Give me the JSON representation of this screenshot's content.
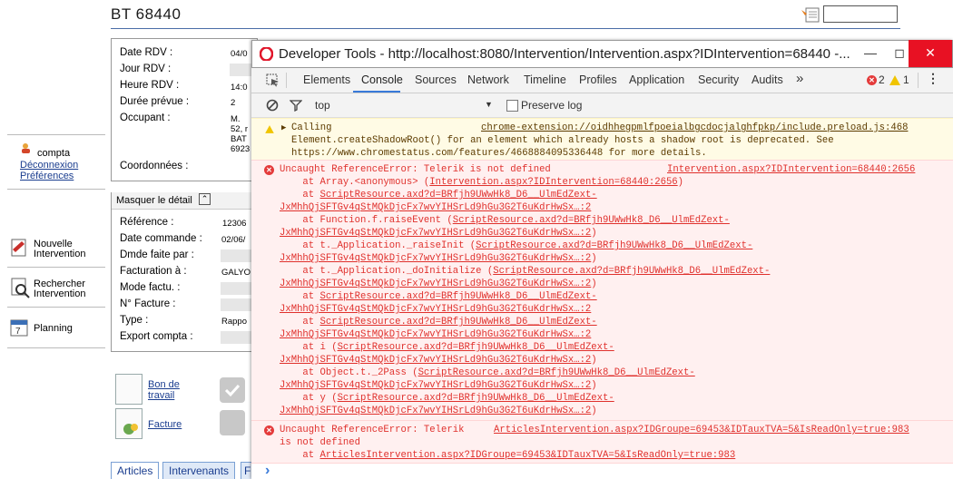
{
  "page": {
    "title": "BT 68440",
    "sidebar": {
      "user": "compta",
      "logout": "Déconnexion",
      "prefs": "Préférences",
      "nouvelle": [
        "Nouvelle",
        "Intervention"
      ],
      "rechercher": [
        "Rechercher",
        "Intervention"
      ],
      "planning": "Planning"
    },
    "panel1": {
      "labels": [
        "Date RDV :",
        "Jour RDV :",
        "Heure RDV :",
        "Durée prévue :",
        "Occupant :",
        "Coordonnées :"
      ],
      "values": [
        "04/0",
        "14:0",
        "2",
        "M.",
        "52, r",
        "BAT",
        "6923"
      ]
    },
    "masquer": "Masquer le détail",
    "panel2": {
      "labels": [
        "Référence :",
        "Date commande :",
        "Dmde faite par :",
        "Facturation à :",
        "Mode factu. :",
        "N° Facture :",
        "Type :",
        "Export compta :"
      ],
      "values": [
        "12306",
        "02/06/",
        "GALYO",
        "Rappo"
      ]
    },
    "bon_de_travail": [
      "Bon de",
      "travail"
    ],
    "facture": "Facture",
    "tabs": [
      "Articles",
      "Intervenants",
      "F"
    ]
  },
  "devtools": {
    "title": "Developer Tools - http://localhost:8080/Intervention/Intervention.aspx?IDIntervention=68440 -...",
    "tabs": [
      "Elements",
      "Console",
      "Sources",
      "Network",
      "Timeline",
      "Profiles",
      "Application",
      "Security",
      "Audits"
    ],
    "active_tab": "Console",
    "more": "»",
    "error_count": "2",
    "warn_count": "1",
    "filter_context": "top",
    "preserve_log": "Preserve log",
    "warning": {
      "text1": "Calling",
      "source": "chrome-extension://oidhhegpmlfpoeialbgcdocjalghfpkp/include.preload.js:468",
      "text2": "Element.createShadowRoot() for an element which already hosts a shadow root is deprecated. See",
      "text3": "https://www.chromestatus.com/features/4668884095336448 for more details."
    },
    "error1": {
      "message": "Uncaught ReferenceError: Telerik is not defined",
      "source": "Intervention.aspx?IDIntervention=68440:2656",
      "stack": [
        {
          "pre": "    at Array.<anonymous> (",
          "link": "Intervention.aspx?IDIntervention=68440:2656",
          "post": ")"
        },
        {
          "pre": "    at ",
          "link": "ScriptResource.axd?d=BRfjh9UWwHk8_D6__UlmEdZext-",
          "post": ""
        },
        {
          "pre": "",
          "link": "JxMhhQjSFTGv4qStMQkDjcFx7wvYIHSrLd9hGu3G2T6uKdrHwSx…:2",
          "post": ""
        },
        {
          "pre": "    at Function.f.raiseEvent (",
          "link": "ScriptResource.axd?d=BRfjh9UWwHk8_D6__UlmEdZext-",
          "post": ""
        },
        {
          "pre": "",
          "link": "JxMhhQjSFTGv4qStMQkDjcFx7wvYIHSrLd9hGu3G2T6uKdrHwSx…:2",
          "post": ")"
        },
        {
          "pre": "    at t._Application._raiseInit (",
          "link": "ScriptResource.axd?d=BRfjh9UWwHk8_D6__UlmEdZext-",
          "post": ""
        },
        {
          "pre": "",
          "link": "JxMhhQjSFTGv4qStMQkDjcFx7wvYIHSrLd9hGu3G2T6uKdrHwSx…:2",
          "post": ")"
        },
        {
          "pre": "    at t._Application._doInitialize (",
          "link": "ScriptResource.axd?d=BRfjh9UWwHk8_D6__UlmEdZext-",
          "post": ""
        },
        {
          "pre": "",
          "link": "JxMhhQjSFTGv4qStMQkDjcFx7wvYIHSrLd9hGu3G2T6uKdrHwSx…:2",
          "post": ")"
        },
        {
          "pre": "    at ",
          "link": "ScriptResource.axd?d=BRfjh9UWwHk8_D6__UlmEdZext-",
          "post": ""
        },
        {
          "pre": "",
          "link": "JxMhhQjSFTGv4qStMQkDjcFx7wvYIHSrLd9hGu3G2T6uKdrHwSx…:2",
          "post": ""
        },
        {
          "pre": "    at ",
          "link": "ScriptResource.axd?d=BRfjh9UWwHk8_D6__UlmEdZext-",
          "post": ""
        },
        {
          "pre": "",
          "link": "JxMhhQjSFTGv4qStMQkDjcFx7wvYIHSrLd9hGu3G2T6uKdrHwSx…:2",
          "post": ""
        },
        {
          "pre": "    at i (",
          "link": "ScriptResource.axd?d=BRfjh9UWwHk8_D6__UlmEdZext-",
          "post": ""
        },
        {
          "pre": "",
          "link": "JxMhhQjSFTGv4qStMQkDjcFx7wvYIHSrLd9hGu3G2T6uKdrHwSx…:2",
          "post": ")"
        },
        {
          "pre": "    at Object.t._2Pass (",
          "link": "ScriptResource.axd?d=BRfjh9UWwHk8_D6__UlmEdZext-",
          "post": ""
        },
        {
          "pre": "",
          "link": "JxMhhQjSFTGv4qStMQkDjcFx7wvYIHSrLd9hGu3G2T6uKdrHwSx…:2",
          "post": ")"
        },
        {
          "pre": "    at y (",
          "link": "ScriptResource.axd?d=BRfjh9UWwHk8_D6__UlmEdZext-",
          "post": ""
        },
        {
          "pre": "",
          "link": "JxMhhQjSFTGv4qStMQkDjcFx7wvYIHSrLd9hGu3G2T6uKdrHwSx…:2",
          "post": ")"
        }
      ]
    },
    "error2": {
      "message1": "Uncaught ReferenceError: Telerik",
      "message2": "is not defined",
      "source": "ArticlesIntervention.aspx?IDGroupe=69453&IDTauxTVA=5&IsReadOnly=true:983",
      "stack_pre": "    at ",
      "stack_link": "ArticlesIntervention.aspx?IDGroupe=69453&IDTauxTVA=5&IsReadOnly=true:983"
    },
    "prompt": "›"
  }
}
